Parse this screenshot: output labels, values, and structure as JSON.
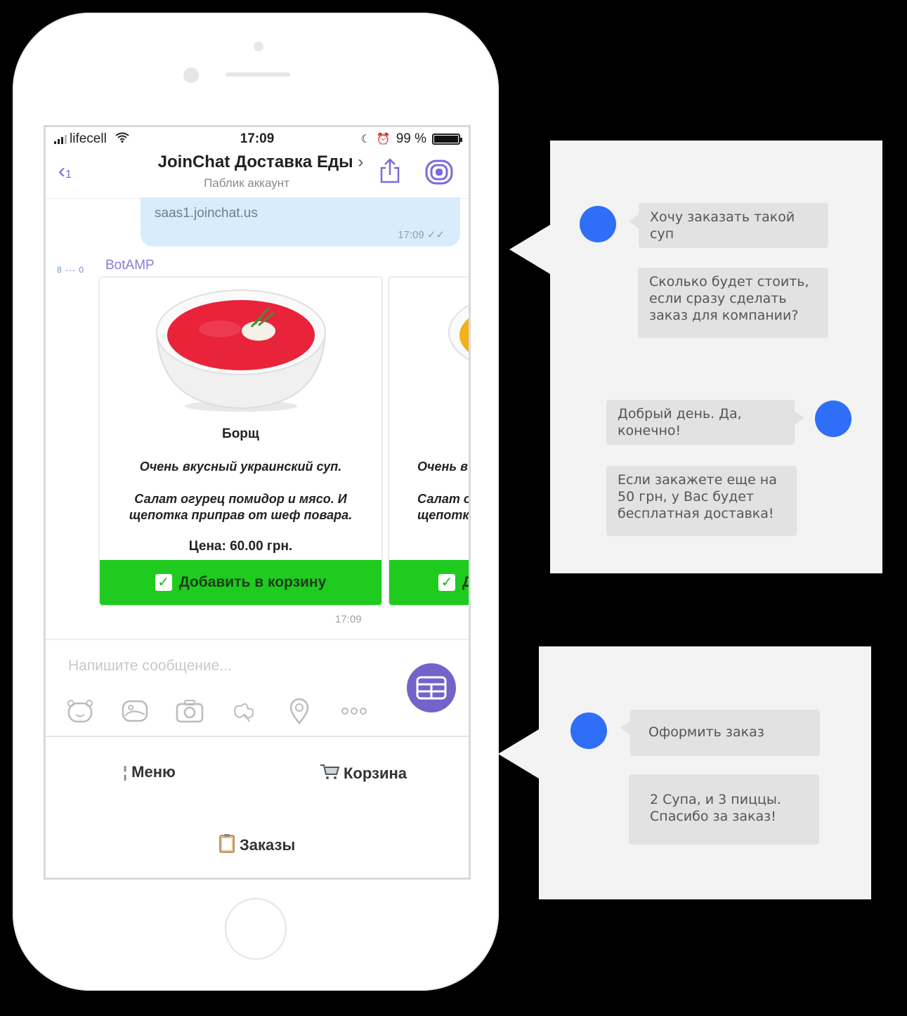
{
  "status_bar": {
    "carrier": "lifecell",
    "time": "17:09",
    "battery": "99 %",
    "battery_level": 0.99
  },
  "chat_header": {
    "back_count": "1",
    "title": "JoinChat Доставка Еды",
    "chevron": "›",
    "subtitle": "Паблик аккаунт"
  },
  "outgoing_message": {
    "text": "saas1.joinchat.us",
    "time": "17:09"
  },
  "bot": {
    "name": "BotAMP",
    "avatar_text": "8 --- 0"
  },
  "cards": [
    {
      "name": "Борщ",
      "desc1": "Очень вкусный украинский суп.",
      "desc2": "Салат огурец помидор и мясо. И щепотка приправ от шеф повара.",
      "price": "Цена: 60.00 грн.",
      "button": "Добавить в корзину"
    },
    {
      "name": "",
      "desc1": "Очень в",
      "desc2": "Салат о щепотка",
      "price": "",
      "button": "Д"
    }
  ],
  "carousel_time": "17:09",
  "composer": {
    "placeholder": "Напишите сообщение..."
  },
  "keyboard": {
    "menu": "Меню",
    "cart": "Корзина",
    "orders": "Заказы"
  },
  "callout_1": {
    "user_msg_1": "Хочу заказать такой суп",
    "user_msg_2": "Сколько будет стоить, если сразу сделать заказ для компании?",
    "reply_1": "Добрый день. Да, конечно!",
    "reply_2": "Если закажете еще на 50 грн, у Вас будет бесплатная доставка!"
  },
  "callout_2": {
    "user_msg_1": "Оформить заказ",
    "user_msg_2": "2 Супа, и 3 пиццы. Спасибо за заказ!"
  },
  "colors": {
    "accent": "#7463c9",
    "button_green": "#1fcb1f",
    "dot_blue": "#2f6ef7",
    "bubble_gray": "#e2e2e2"
  }
}
